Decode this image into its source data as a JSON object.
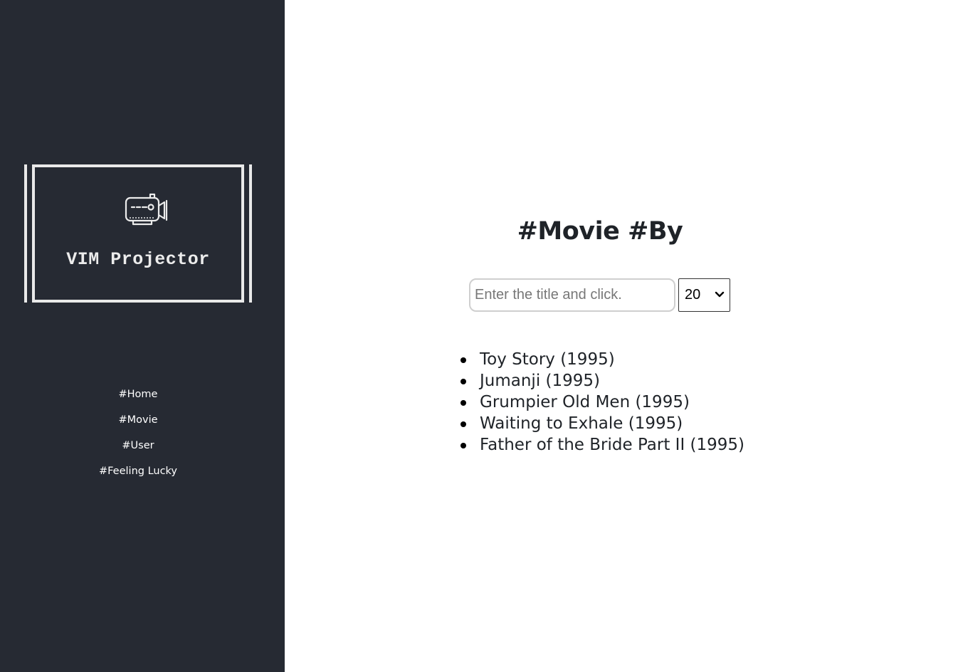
{
  "sidebar": {
    "logo": {
      "icon": "movie-camera-icon",
      "title": "VIM Projector"
    },
    "nav": [
      {
        "label": "#Home"
      },
      {
        "label": "#Movie"
      },
      {
        "label": "#User"
      },
      {
        "label": "#Feeling Lucky"
      }
    ]
  },
  "main": {
    "title": "#Movie #By",
    "search": {
      "placeholder": "Enter the title and click.",
      "value": ""
    },
    "count_select": {
      "selected": "20"
    },
    "movies": [
      "Toy Story (1995)",
      "Jumanji (1995)",
      "Grumpier Old Men (1995)",
      "Waiting to Exhale (1995)",
      "Father of the Bride Part II (1995)"
    ]
  },
  "colors": {
    "sidebar_bg": "#262a33",
    "sidebar_text": "#ffffff",
    "logo_stroke": "#e9e9e9",
    "main_bg": "#ffffff",
    "text_dark": "#1f2328"
  }
}
